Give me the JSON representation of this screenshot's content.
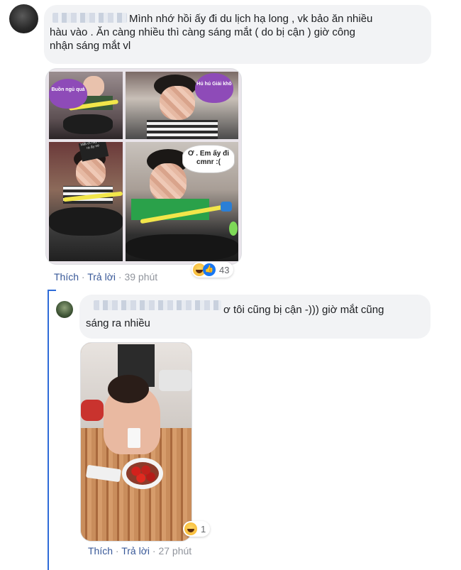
{
  "comments": [
    {
      "text_line1": "Mình nhớ hồi ấy đi du lịch hạ long , vk bảo ăn nhiều",
      "text_line2": "hàu vào . Ăn càng nhiều thì càng sáng mắt ( do bị cận ) giờ công",
      "text_line3": "nhận sáng mắt vl",
      "photo_captions": {
        "panel1_heart": "Buồn ngủ quá",
        "panel2_heart": "Hú hú Giải khô",
        "panel3_box": "Mắt ơi hãy tỉnh ra ấy nè",
        "panel4_speech": "Ơ . Em ấy đi cmnr :("
      },
      "actions": {
        "like": "Thích",
        "separator": "·",
        "reply": "Trả lời",
        "time": "39 phút"
      },
      "reactions": {
        "icons": [
          "haha-icon",
          "like-icon"
        ],
        "count": "43"
      }
    },
    {
      "text_line1": "ơ tôi cũng bị cận -))) giờ mắt cũng",
      "text_line2": "sáng ra nhiều",
      "actions": {
        "like": "Thích",
        "separator": "·",
        "reply": "Trả lời",
        "time": "27 phút"
      },
      "reactions": {
        "icons": [
          "haha-icon"
        ],
        "count": "1"
      }
    }
  ],
  "colors": {
    "link": "#385898",
    "muted": "#90949c",
    "bubble": "#f2f3f5",
    "thread": "#2e6bd8"
  }
}
